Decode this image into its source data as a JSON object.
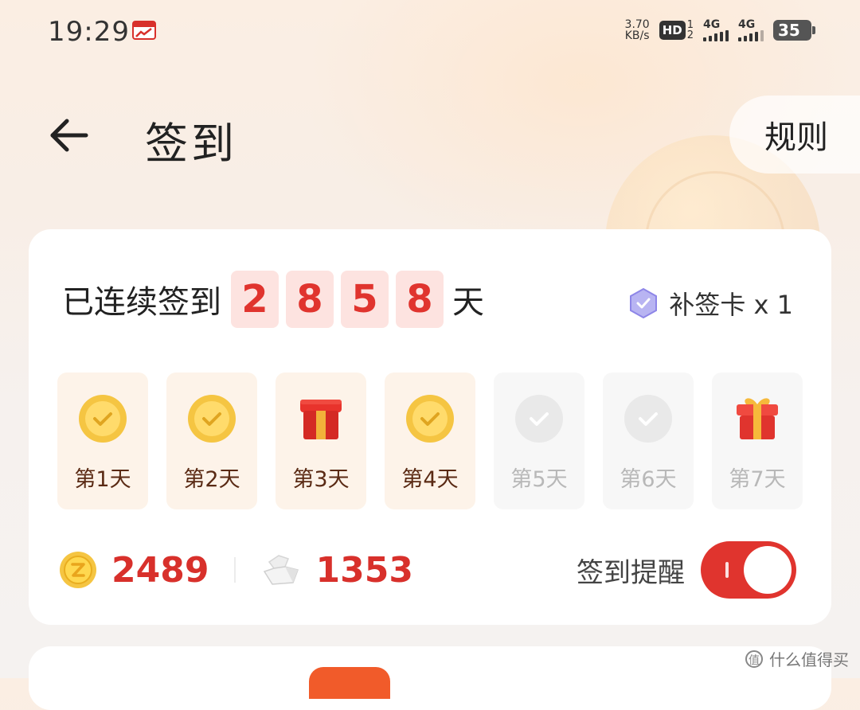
{
  "status_bar": {
    "time": "19:29",
    "net_speed_value": "3.70",
    "net_speed_unit": "KB/s",
    "hd_label": "HD",
    "hd_sub_top": "1",
    "hd_sub_bottom": "2",
    "sim1_label": "4G",
    "sim2_label": "4G",
    "battery": "35"
  },
  "header": {
    "title": "签到",
    "rules_label": "规则"
  },
  "card": {
    "streak_prefix": "已连续签到",
    "streak_digits": [
      "2",
      "8",
      "5",
      "8"
    ],
    "streak_suffix": "天",
    "makeup_label": "补签卡 x 1",
    "days": [
      {
        "label": "第1天",
        "state": "done",
        "icon": "check-coin-icon"
      },
      {
        "label": "第2天",
        "state": "done",
        "icon": "check-coin-icon"
      },
      {
        "label": "第3天",
        "state": "done",
        "icon": "gift-box-icon"
      },
      {
        "label": "第4天",
        "state": "done",
        "icon": "check-coin-icon"
      },
      {
        "label": "第5天",
        "state": "todo",
        "icon": "check-coin-icon"
      },
      {
        "label": "第6天",
        "state": "todo",
        "icon": "check-coin-icon"
      },
      {
        "label": "第7天",
        "state": "todo",
        "icon": "gift-icon"
      }
    ],
    "gold_coins": "2489",
    "silver_count": "1353",
    "remind_label": "签到提醒",
    "remind_on": true
  },
  "watermark": "什么值得买",
  "colors": {
    "accent_red": "#e0342e",
    "coin_gold": "#f5c542",
    "done_bg": "#fdf3e9",
    "todo_bg": "#f7f7f7"
  }
}
